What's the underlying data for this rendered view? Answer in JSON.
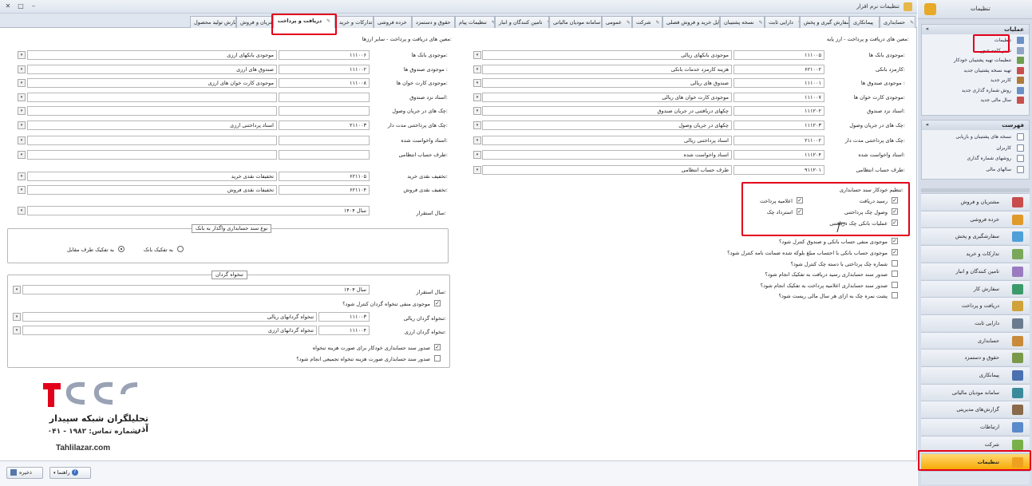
{
  "window": {
    "title": "تنظیمات نرم افزار"
  },
  "tabs": [
    "حسابداری",
    "پیمانکاری",
    "سفارش گیری و پخش",
    "دارایی ثابت",
    "نسخه پشتیبان",
    "فایل خرید و فروش فصلی",
    "شرکت",
    "عمومی",
    "سامانه مودیان مالیاتی",
    "تامین کنندگان و انبار",
    "تنظیمات پیام",
    "حقوق و دستمزد",
    "خرده فروشی",
    "تدارکات و خرید",
    "دریافت و پرداخت",
    "مشتریان و فروش",
    "سفارش تولید محصول"
  ],
  "right_form": {
    "header": "معین های دریافت و پرداخت - ارز پایه:",
    "rows": [
      {
        "label": "موجودی بانک ها:",
        "code": "۱۱۱۰۰۵",
        "value": "موجودی بانکهای ریالی"
      },
      {
        "label": "کارمزد بانکی:",
        "code": "۶۲۱۰۰۲",
        "value": "هزینه کارمزد خدمات بانکی"
      },
      {
        "label": "موجودی صندوق ها :",
        "code": "۱۱۱۰۰۱",
        "value": "صندوق های ریالی"
      },
      {
        "label": "موجودی کارت خوان ها:",
        "code": "۱۱۱۰۰۷",
        "value": "موجودی کارت خوان های ریالی"
      },
      {
        "label": "اسناد نزد صندوق:",
        "code": "۱۱۱۲۰۲",
        "value": "چکهای دریافتنی در جریان صندوق"
      },
      {
        "label": "چک های در جریان وصول:",
        "code": "۱۱۱۲۰۳",
        "value": "چکهای در جریان وصول"
      },
      {
        "label": "چک های پرداختنی مدت دار:",
        "code": "۲۱۱۰۰۲",
        "value": "اسناد پرداختنی ریالی"
      },
      {
        "label": "اسناد واخواست شده:",
        "code": "۱۱۱۲۰۴",
        "value": "اسناد واخواست شده"
      },
      {
        "label": "طرف حساب انتظامی:",
        "code": "۹۱۱۲۰۱",
        "value": "طرف حساب انتظامی"
      }
    ]
  },
  "auto_doc": {
    "title": "تنظیم خودکار سند حسابداری:",
    "items": [
      "رسید دریافت",
      "اعلامیه پرداخت",
      "وصول چک پرداختنی",
      "استرداد چک",
      "عملیات بانکی چک دریافتنی"
    ]
  },
  "options": [
    {
      "text": "موجودی منفی حساب بانکی و صندوق کنترل شود؟",
      "checked": true
    },
    {
      "text": "موجودی حساب بانکی با احتساب مبلغ بلوکه شده ضمانت نامه کنترل شود؟",
      "checked": true
    },
    {
      "text": "شماره چک پرداختی با دسته چک کنترل شود؟",
      "checked": false
    },
    {
      "text": "صدور سند حسابداری رسید دریافت به تفکیک انجام شود؟",
      "checked": false
    },
    {
      "text": "صدور سند حسابداری اعلامیه پرداخت به تفکیک انجام شود؟",
      "checked": false
    },
    {
      "text": "پشت نمره چک به ازای هر سال مالی ریست شود؟",
      "checked": false
    }
  ],
  "left_form": {
    "header": "معین های دریافت و پرداخت - سایر ارزها:",
    "rows": [
      {
        "label": "موجودی بانک ها:",
        "code": "۱۱۱۰۰۶",
        "value": "موجودی بانکهای ارزی"
      },
      {
        "label": "موجودی صندوق ها :",
        "code": "۱۱۱۰۰۲",
        "value": "صندوق های ارزی"
      },
      {
        "label": "موجودی کارت خوان ها:",
        "code": "۱۱۱۰۰۸",
        "value": "موجودی کارت خوان های ارزی"
      },
      {
        "label": "اسناد نزد صندوق:",
        "code": "",
        "value": ""
      },
      {
        "label": "چک های در جریان وصول:",
        "code": "",
        "value": ""
      },
      {
        "label": "چک های پرداختنی مدت دار:",
        "code": "۲۱۱۰۰۳",
        "value": "اسناد پرداختنی ارزی"
      },
      {
        "label": "اسناد واخواست شده:",
        "code": "",
        "value": ""
      },
      {
        "label": "طرف حساب انتظامی:",
        "code": "",
        "value": ""
      }
    ],
    "discounts": [
      {
        "label": "تخفیف نقدی خرید:",
        "code": "۶۲۱۱۰۵",
        "value": "تخفیفات نقدی خرید"
      },
      {
        "label": "تخفیف نقدی فروش:",
        "code": "۶۲۱۱۰۴",
        "value": "تخفیفات نقدی فروش"
      }
    ],
    "year_label": "سال استقرار:",
    "year_value": "سال ۱۴۰۴"
  },
  "bank_group": {
    "title": "نوع سند حسابداری واگذار به بانک",
    "opt1": "به تفکیک بانک",
    "opt2": "به تفکیک طرف مقابل"
  },
  "petty_group": {
    "title": "تنخواه گردان",
    "year_label": "سال استقرار:",
    "year_value": "سال ۱۴۰۴",
    "neg_check": "موجودی منفی تنخواه گردان کنترل شود؟",
    "rial_label": "تنخواه گردان ریالی:",
    "rial_code": "۱۱۱۰۰۳",
    "rial_value": "تنخواه گردانهای ریالی",
    "fx_label": "تنخواه گردان ارزی:",
    "fx_code": "۱۱۱۰۰۴",
    "fx_value": "تنخواه گردانهای ارزی",
    "auto1": "صدور سند حسابداری خودکار برای صورت هزینه تنخواه",
    "auto2": "صدور سند حسابداری صورت هزینه تنخواه تجمیعی انجام شود؟"
  },
  "logo": {
    "name": "تحلیلگران شبکه سپیدار آذر",
    "phone": "شماره تماس: ۱۹۸۲ - ۰۴۱",
    "site": "Tahlilazar.com"
  },
  "bottom": {
    "save": "ذخیره",
    "help": "راهنما"
  },
  "side": {
    "header": "تنظیمات",
    "ops_title": "عملیات",
    "ops": [
      "تنظیمات",
      "تغییر کلمه عبور",
      "تنظیمات تهیه پشتیبان خودکار",
      "تهیه نسخه پشتیبان جدید",
      "کاربر جدید",
      "روش شماره گذاری جدید",
      "سال مالی جدید"
    ],
    "list_title": "فهرست",
    "list": [
      "نسخه های پشتیبان و بازیابی",
      "کاربران",
      "روشهای شماره گذاری",
      "سالهای مالی"
    ],
    "nav": [
      "مشتریان و فروش",
      "خرده فروشی",
      "سفارشگیری و پخش",
      "تدارکات و خرید",
      "تامین کنندگان و انبار",
      "سفارش کار",
      "دریافت و پرداخت",
      "دارایی ثابت",
      "حسابداری",
      "حقوق و دستمزد",
      "پیمانکاری",
      "سامانه مودیان مالیاتی",
      "گزارش‌های مدیریتی",
      "ارتباطات",
      "شرکت",
      "تنظیمات"
    ]
  }
}
